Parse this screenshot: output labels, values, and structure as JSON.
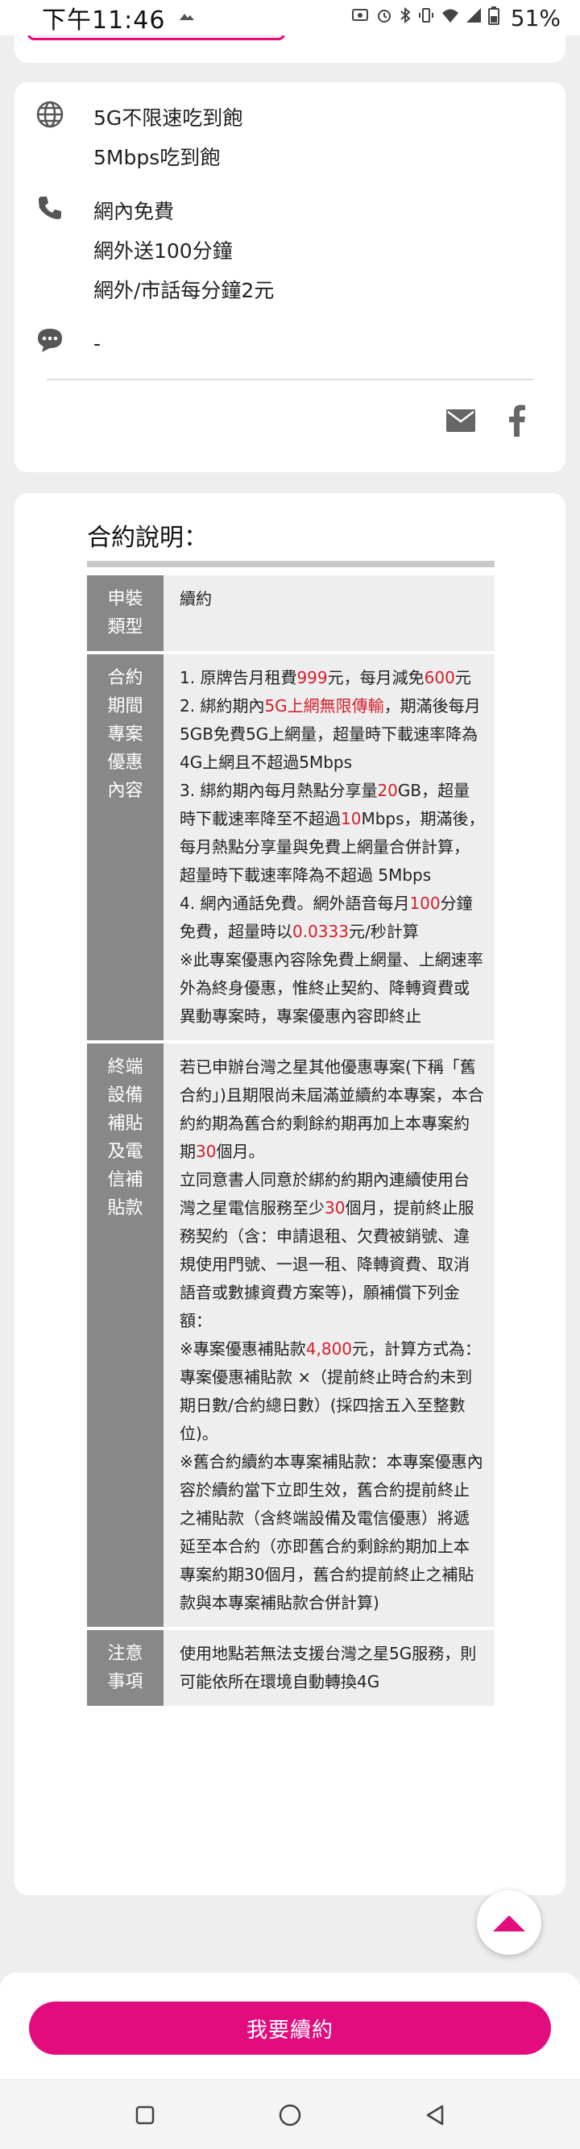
{
  "status_bar": {
    "time": "下午11:46",
    "battery": "51%",
    "left_icons": [
      "notification-icon"
    ],
    "right_icons": [
      "cast-icon",
      "alarm-icon",
      "bluetooth-icon",
      "vibrate-icon",
      "wifi-icon",
      "signal-icon",
      "battery-icon"
    ]
  },
  "plan_features": {
    "data": {
      "icon": "globe-icon",
      "lines": [
        "5G不限速吃到飽",
        "5Mbps吃到飽"
      ]
    },
    "voice": {
      "icon": "phone-icon",
      "lines": [
        "網內免費",
        "網外送100分鐘",
        "網外/市話每分鐘2元"
      ]
    },
    "sms": {
      "icon": "chat-bubble-icon",
      "lines": [
        "-"
      ]
    },
    "share": [
      "mail-icon",
      "facebook-icon"
    ]
  },
  "contract": {
    "title": "合約說明：",
    "rows": [
      {
        "label": "申裝類型",
        "paragraphs": [
          "續約"
        ]
      },
      {
        "label": "合約期間專案優惠內容",
        "paragraphs": [
          "1. 原牌告月租費999元，每月減免600元",
          "2. 綁約期內5G上網無限傳輸，期滿後每月5GB免費5G上網量，超量時下載速率降為4G上網且不超過5Mbps",
          "3. 綁約期內每月熱點分享量20GB，超量時下載速率降至不超過10Mbps，期滿後，每月熱點分享量與免費上網量合併計算，超量時下載速率降為不超過 5Mbps",
          "4. 網內通話免費。網外語音每月100分鐘免費，超量時以0.0333元/秒計算",
          "※此專案優惠內容除免費上網量、上網速率外為終身優惠，惟終止契約、降轉資費或異動專案時，專案優惠內容即終止"
        ]
      },
      {
        "label": "終端設備補貼及電信補貼款",
        "paragraphs": [
          "若已申辦台灣之星其他優惠專案(下稱「舊合約」)且期限尚未屆滿並續約本專案，本合約約期為舊合約剩餘約期再加上本專案約期30個月。",
          "立同意書人同意於綁約約期內連續使用台灣之星電信服務至少30個月，提前終止服務契約（含：申請退租、欠費被銷號、違規使用門號、一退一租、降轉資費、取消語音或數據資費方案等)，願補償下列金額：",
          "※專案優惠補貼款4,800元，計算方式為：專案優惠補貼款 ×（提前終止時合約未到期日數/合約總日數）(採四捨五入至整數位)。",
          "※舊合約續約本專案補貼款：本專案優惠內容於續約當下立即生效，舊合約提前終止之補貼款（含終端設備及電信優惠）將遞延至本合約（亦即舊合約剩餘約期加上本專案約期30個月，舊合約提前終止之補貼款與本專案補貼款合併計算)"
        ]
      },
      {
        "label": "注意事項",
        "paragraphs": [
          "使用地點若無法支援台灣之星5G服務，則可能依所在環境自動轉換4G"
        ]
      }
    ]
  },
  "cta": {
    "label": "我要續約"
  },
  "colors": {
    "accent": "#e20c7f",
    "highlight": "#d31f2b",
    "label_bg": "#888888",
    "value_bg": "#eeeeee"
  },
  "nav": [
    "recent-apps-icon",
    "home-icon",
    "back-icon"
  ]
}
